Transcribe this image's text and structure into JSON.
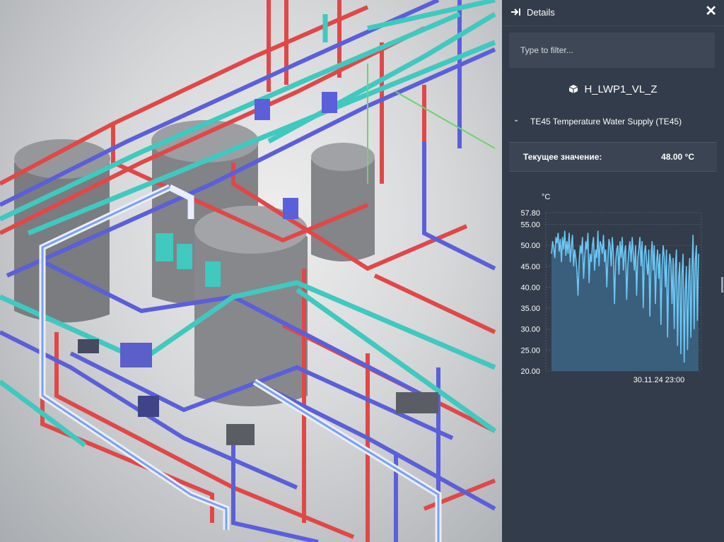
{
  "panel": {
    "title": "Details",
    "close_icon": "close-icon",
    "pin_icon": "panel-dock-icon",
    "filter_placeholder": "Type to filter...",
    "object_name": "H_LWP1_VL_Z",
    "object_icon": "cube-icon",
    "section_label": "TE45 Temperature Water Supply (TE45)",
    "property": {
      "key": "Текущее значение:",
      "value": "48.00 °C"
    }
  },
  "chart_data": {
    "type": "area",
    "unit_label": "°C",
    "yticks": [
      "57.80",
      "55.00",
      "50.00",
      "45.00",
      "40.00",
      "35.00",
      "30.00",
      "25.00",
      "20.00"
    ],
    "ylim": [
      20,
      57.8
    ],
    "x_tick": "30.11.24 23:00",
    "grid": true,
    "color": "#6cc7f5",
    "fill": "#3a5f7c",
    "values": [
      48,
      51,
      49.5,
      47,
      52,
      50.5,
      53,
      48.5,
      51.5,
      46,
      52,
      49,
      53.5,
      47.5,
      51,
      48,
      53,
      46,
      50,
      52.5,
      45,
      49,
      47,
      44,
      38,
      46,
      50,
      48,
      52,
      42,
      47,
      51,
      49,
      53,
      41,
      48,
      46,
      50,
      52,
      44,
      49,
      47,
      53.5,
      45,
      51,
      50,
      48,
      52.5,
      46,
      49,
      40,
      47,
      51.5,
      50,
      45,
      52,
      48,
      36,
      46,
      49,
      50,
      43,
      51,
      47,
      52,
      44,
      48,
      50,
      37,
      45,
      49,
      51,
      46,
      52,
      48,
      44,
      50,
      38,
      47,
      49,
      52,
      45,
      51,
      35,
      48,
      50,
      46,
      43,
      49,
      33,
      47,
      51,
      44,
      50,
      36,
      46,
      49,
      42,
      48,
      31,
      45,
      50,
      47,
      40,
      49,
      28,
      44,
      48,
      46,
      36,
      47,
      30,
      45,
      49,
      26,
      42,
      46,
      24,
      43,
      48,
      22,
      39,
      45,
      25,
      41,
      47,
      28,
      44,
      52.5,
      30,
      46,
      50,
      32,
      48
    ]
  }
}
